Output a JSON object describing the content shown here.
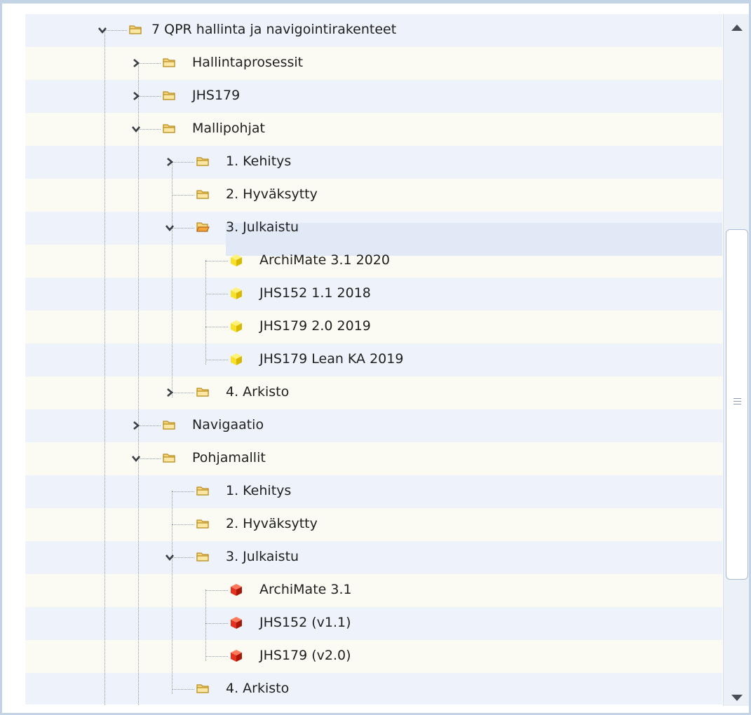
{
  "tree": {
    "items": [
      {
        "label": "7 QPR hallinta ja navigointirakenteet",
        "toggle": "expanded",
        "icon": "folder-icon"
      },
      {
        "label": "Hallintaprosessit",
        "toggle": "collapsed",
        "icon": "folder-icon"
      },
      {
        "label": "JHS179",
        "toggle": "collapsed",
        "icon": "folder-icon"
      },
      {
        "label": "Mallipohjat",
        "toggle": "expanded",
        "icon": "folder-icon"
      },
      {
        "label": "1. Kehitys",
        "toggle": "collapsed",
        "icon": "folder-icon"
      },
      {
        "label": "2. Hyväksytty",
        "toggle": "none",
        "icon": "folder-icon"
      },
      {
        "label": "3. Julkaistu",
        "toggle": "expanded",
        "icon": "open-folder-icon",
        "selected": true
      },
      {
        "label": "ArchiMate 3.1 2020",
        "toggle": "none",
        "icon": "yellow-cube-icon"
      },
      {
        "label": "JHS152 1.1 2018",
        "toggle": "none",
        "icon": "yellow-cube-icon"
      },
      {
        "label": "JHS179 2.0 2019",
        "toggle": "none",
        "icon": "yellow-cube-icon"
      },
      {
        "label": "JHS179 Lean KA 2019",
        "toggle": "none",
        "icon": "yellow-cube-icon"
      },
      {
        "label": "4. Arkisto",
        "toggle": "collapsed",
        "icon": "folder-icon"
      },
      {
        "label": "Navigaatio",
        "toggle": "collapsed",
        "icon": "folder-icon"
      },
      {
        "label": "Pohjamallit",
        "toggle": "expanded",
        "icon": "folder-icon"
      },
      {
        "label": "1. Kehitys",
        "toggle": "none",
        "icon": "folder-icon"
      },
      {
        "label": "2. Hyväksytty",
        "toggle": "none",
        "icon": "folder-icon"
      },
      {
        "label": "3. Julkaistu",
        "toggle": "expanded",
        "icon": "folder-icon"
      },
      {
        "label": "ArchiMate 3.1",
        "toggle": "none",
        "icon": "red-cube-icon"
      },
      {
        "label": "JHS152 (v1.1)",
        "toggle": "none",
        "icon": "red-cube-icon"
      },
      {
        "label": "JHS179 (v2.0)",
        "toggle": "none",
        "icon": "red-cube-icon"
      },
      {
        "label": "4. Arkisto",
        "toggle": "none",
        "icon": "folder-icon"
      }
    ]
  },
  "scrollbar": {
    "up_icon": "scroll-up-arrow-icon",
    "down_icon": "scroll-down-arrow-icon",
    "grip_icon": "grip-lines-icon"
  },
  "colors": {
    "row_odd": "#eef3fb",
    "row_even": "#fcfbf3",
    "selected_row": "#e0e9f5",
    "border": "#c3d3e6",
    "folder_fill": "#f5d67a",
    "cube_yellow": "#f7e12c",
    "cube_red": "#e4331e"
  }
}
